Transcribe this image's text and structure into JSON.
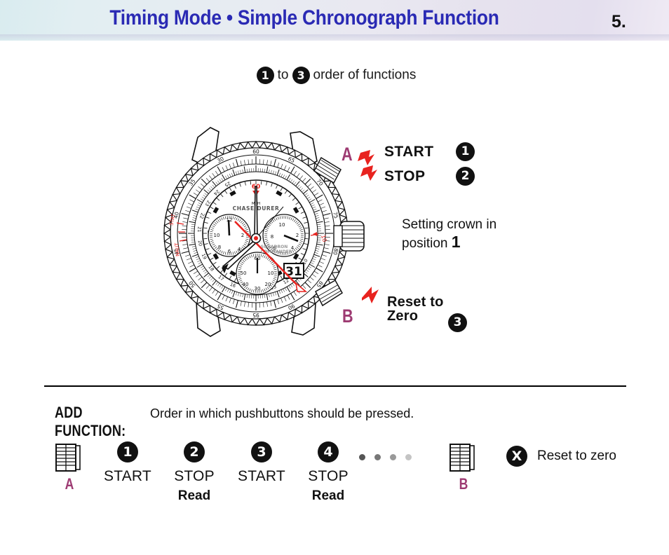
{
  "header": {
    "title": "Timing Mode • Simple Chronograph Function",
    "page_number": "5.",
    "title_color": "#2a2ab4"
  },
  "subtitle": {
    "first_number": "1",
    "connector": "to",
    "second_number": "3",
    "text": "order of functions"
  },
  "watch": {
    "brand": "CHASE-DURER",
    "model_line1": "SQUADRON",
    "model_line2": "COMMANDER",
    "date_window": "31",
    "bezel_unit": "MPH",
    "subdial_left_ticks": [
      "10",
      "2",
      "8",
      "4"
    ],
    "subdial_right_ticks": [
      "10",
      "2",
      "8",
      "4"
    ],
    "subdial_bottom_ticks": [
      "60",
      "50",
      "40",
      "30",
      "20",
      "10"
    ],
    "outer_scale_labels": [
      "60",
      "65",
      "70",
      "75",
      "80",
      "85",
      "90",
      "95",
      "55",
      "50",
      "45",
      "40",
      "35",
      "30"
    ],
    "inner_scale_labels": [
      "10",
      "11",
      "12",
      "13",
      "14",
      "15",
      "16",
      "17",
      "18",
      "19",
      "20",
      "21",
      "22",
      "23",
      "24",
      "25"
    ],
    "stat_label": "STAT",
    "naut_label": "NAUT",
    "accent_red": "#e8231f"
  },
  "callouts": {
    "pusher_a_letter": "A",
    "pusher_b_letter": "B",
    "letter_color": "#9d3a72",
    "start_label": "START",
    "start_number": "1",
    "stop_label": "STOP",
    "stop_number": "2",
    "crown_text_line1": "Setting crown in",
    "crown_text_line2_prefix": "position ",
    "crown_position": "1",
    "reset_line1": "Reset to",
    "reset_line2": "Zero",
    "reset_number": "3"
  },
  "add_function": {
    "key": "ADD FUNCTION:",
    "value": "Order in which pushbuttons should be pressed."
  },
  "steps_row": {
    "pusher_a": "A",
    "pusher_b": "B",
    "steps": [
      {
        "number": "1",
        "action": "START",
        "read": ""
      },
      {
        "number": "2",
        "action": "STOP",
        "read": "Read"
      },
      {
        "number": "3",
        "action": "START",
        "read": ""
      },
      {
        "number": "4",
        "action": "STOP",
        "read": "Read"
      }
    ],
    "dots": [
      "#555555",
      "#777777",
      "#999999",
      "#c4c4c4"
    ],
    "reset_marker": "X",
    "reset_text": "Reset to zero"
  }
}
